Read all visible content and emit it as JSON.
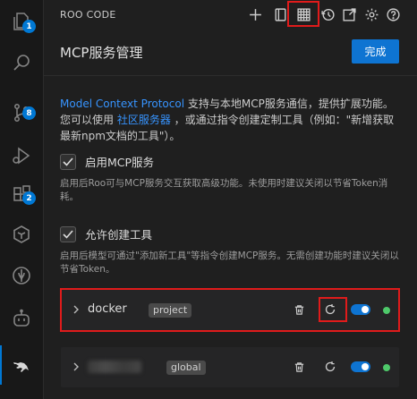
{
  "activity_bar": {
    "items": [
      {
        "name": "explorer",
        "badge": "1"
      },
      {
        "name": "search",
        "badge": ""
      },
      {
        "name": "source-control",
        "badge": "8"
      },
      {
        "name": "run-debug",
        "badge": ""
      },
      {
        "name": "extensions",
        "badge": "2"
      },
      {
        "name": "cube-extension",
        "badge": ""
      },
      {
        "name": "leaf-extension",
        "badge": ""
      },
      {
        "name": "copilot",
        "badge": ""
      },
      {
        "name": "roo-code",
        "badge": "",
        "active": true
      }
    ]
  },
  "topbar": {
    "title": "ROO CODE",
    "icons": [
      "plus-icon",
      "prompts-icon",
      "mcp-servers-icon",
      "history-icon",
      "popout-icon",
      "settings-icon",
      "help-icon"
    ]
  },
  "header": {
    "title": "MCP服务管理",
    "done_label": "完成"
  },
  "description": {
    "link_mcp": "Model Context Protocol",
    "text1": " 支持与本地MCP服务通信，提供扩展功能。您可以使用 ",
    "link_community": "社区服务器",
    "text2": " ，或通过指令创建定制工具（例如：\"新增获取最新npm文档的工具\"）。"
  },
  "options": [
    {
      "label": "启用MCP服务",
      "checked": true,
      "note": "启用后Roo可与MCP服务交互获取高级功能。未使用时建议关闭以节省Token消耗。"
    },
    {
      "label": "允许创建工具",
      "checked": true,
      "note": "启用后模型可通过\"添加新工具\"等指令创建MCP服务。无需创建功能时建议关闭以节省Token。"
    }
  ],
  "servers": [
    {
      "name": "docker",
      "scope": "project",
      "enabled": true,
      "status_color": "#4ec96a"
    },
    {
      "name": "",
      "scope": "global",
      "enabled": true,
      "status_color": "#4ec96a"
    }
  ],
  "colors": {
    "accent": "#0e74d2",
    "highlight": "#e01b1b",
    "status_ok": "#4ec96a"
  }
}
